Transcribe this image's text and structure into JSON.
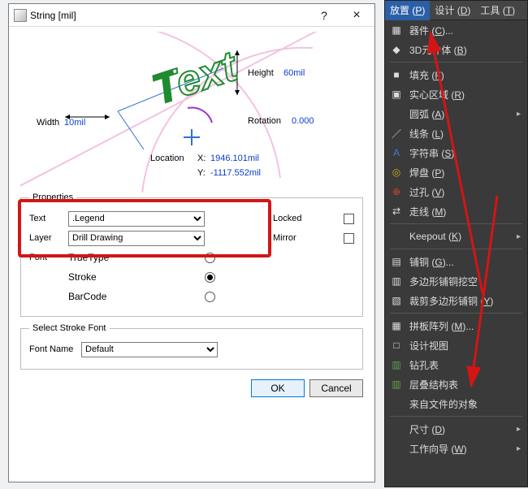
{
  "dialog": {
    "title": "String  [mil]",
    "width_label": "Width",
    "width_value": "10mil",
    "height_label": "Height",
    "height_value": "60mil",
    "rotation_label": "Rotation",
    "rotation_value": "0.000",
    "location_label": "Location",
    "loc_x_label": "X:",
    "loc_x_value": "1946.101mil",
    "loc_y_label": "Y:",
    "loc_y_value": "-1117.552mil",
    "preview_text": "Text",
    "props_legend": "Properties",
    "text_label": "Text",
    "text_value": ".Legend",
    "layer_label": "Layer",
    "layer_value": "Drill Drawing",
    "font_label": "Font",
    "font_truetype": "TrueType",
    "font_stroke": "Stroke",
    "font_barcode": "BarCode",
    "locked_label": "Locked",
    "mirror_label": "Mirror",
    "locked_checked": false,
    "mirror_checked": false,
    "selected_font_mode": "Stroke",
    "stroke_legend": "Select Stroke Font",
    "fontname_label": "Font Name",
    "fontname_value": "Default",
    "ok_label": "OK",
    "cancel_label": "Cancel"
  },
  "menu": {
    "tabs": [
      {
        "label": "放置",
        "mn": "P",
        "active": true
      },
      {
        "label": "设计",
        "mn": "D",
        "active": false
      },
      {
        "label": "工具",
        "mn": "T",
        "active": false
      }
    ],
    "items": [
      {
        "icon": "component-icon",
        "glyph": "▦",
        "label": "器件",
        "mn": "C",
        "suffix": "...",
        "arrow": false
      },
      {
        "icon": "cube-icon",
        "glyph": "◆",
        "label": "3D元件体",
        "mn": "B",
        "arrow": false
      },
      {
        "sep": true
      },
      {
        "icon": "fill-icon",
        "glyph": "■",
        "label": "填充",
        "mn": "F",
        "arrow": false
      },
      {
        "icon": "region-icon",
        "glyph": "▣",
        "label": "实心区域",
        "mn": "R",
        "arrow": false
      },
      {
        "icon": "",
        "glyph": "",
        "label": "圆弧",
        "mn": "A",
        "arrow": true
      },
      {
        "icon": "line-icon",
        "glyph": "／",
        "label": "线条",
        "mn": "L",
        "arrow": false
      },
      {
        "icon": "string-icon",
        "glyph": "A",
        "color": "#3e7ad8",
        "label": "字符串",
        "mn": "S",
        "arrow": false
      },
      {
        "icon": "pad-icon",
        "glyph": "◎",
        "color": "#ccaa22",
        "label": "焊盘",
        "mn": "P",
        "arrow": false
      },
      {
        "icon": "via-icon",
        "glyph": "⊕",
        "color": "#cc4a2a",
        "label": "过孔",
        "mn": "V",
        "arrow": false
      },
      {
        "icon": "track-icon",
        "glyph": "⇄",
        "label": "走线",
        "mn": "M",
        "arrow": false
      },
      {
        "sep": true
      },
      {
        "icon": "",
        "glyph": "",
        "label": "Keepout",
        "mn": "K",
        "arrow": true
      },
      {
        "sep": true
      },
      {
        "icon": "pour-icon",
        "glyph": "▤",
        "label": "铺铜",
        "mn": "G",
        "suffix": "...",
        "arrow": false
      },
      {
        "icon": "cutout-icon",
        "glyph": "▥",
        "label": "多边形铺铜挖空",
        "arrow": false
      },
      {
        "icon": "slice-icon",
        "glyph": "▧",
        "label": "裁剪多边形铺铜",
        "mn": "Y",
        "arrow": false
      },
      {
        "sep": true
      },
      {
        "icon": "array-icon",
        "glyph": "▦",
        "label": "拼板阵列",
        "mn": "M",
        "suffix": "...",
        "arrow": false
      },
      {
        "icon": "view-icon",
        "glyph": "□",
        "label": "设计视图",
        "arrow": false
      },
      {
        "icon": "drilltable-icon",
        "glyph": "▥",
        "color": "#5fa04a",
        "label": "钻孔表",
        "arrow": false
      },
      {
        "icon": "stackup-icon",
        "glyph": "▥",
        "color": "#5fa04a",
        "label": "层叠结构表",
        "arrow": false
      },
      {
        "icon": "",
        "glyph": "",
        "label": "来自文件的对象",
        "arrow": false
      },
      {
        "sep": true
      },
      {
        "icon": "",
        "glyph": "",
        "label": "尺寸",
        "mn": "D",
        "arrow": true
      },
      {
        "icon": "",
        "glyph": "",
        "label": "工作向导",
        "mn": "W",
        "arrow": true
      }
    ]
  }
}
